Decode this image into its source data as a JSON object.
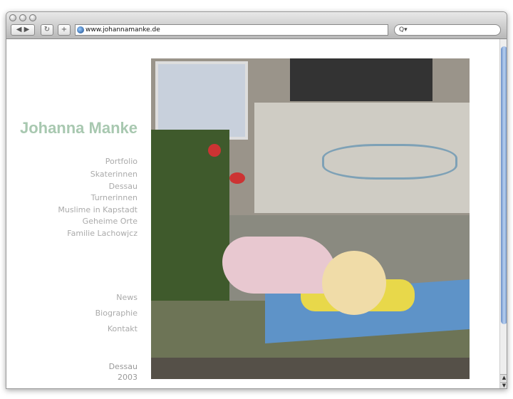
{
  "browser": {
    "url": "www.johannamanke.de",
    "search_icon": "Q▾",
    "back": "◀",
    "forward": "▶",
    "reload": "↻",
    "add": "+"
  },
  "site": {
    "title": "Johanna Manke",
    "portfolio_label": "Portfolio",
    "portfolio_items": [
      "Skaterinnen",
      "Dessau",
      "Turnerinnen",
      "Muslime in Kapstadt",
      "Geheime Orte",
      "Familie Lachowjcz"
    ],
    "links": [
      "News",
      "Biographie",
      "Kontakt"
    ],
    "caption": {
      "series": "Dessau",
      "year": "2003"
    }
  },
  "colors": {
    "title": "#a8c8b0",
    "nav": "#aaaaaa"
  }
}
